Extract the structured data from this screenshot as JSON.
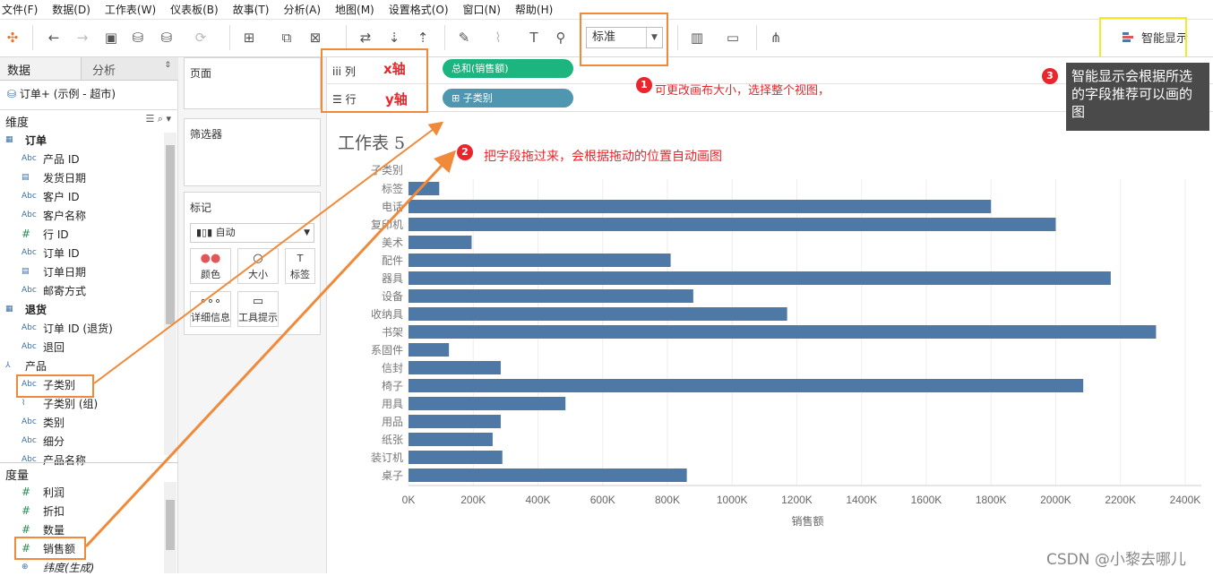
{
  "menu": [
    "文件(F)",
    "数据(D)",
    "工作表(W)",
    "仪表板(B)",
    "故事(T)",
    "分析(A)",
    "地图(M)",
    "设置格式(O)",
    "窗口(N)",
    "帮助(H)"
  ],
  "toolbar": {
    "fit_value": "标准",
    "show_me": "智能显示"
  },
  "left": {
    "tab_data": "数据",
    "tab_analysis": "分析",
    "datasource": "订单+ (示例 - 超市)",
    "dimensions_label": "维度",
    "measures_label": "度量",
    "dimensions": [
      {
        "type": "table",
        "label": "订单"
      },
      {
        "type": "abc",
        "label": "产品 ID"
      },
      {
        "type": "date",
        "label": "发货日期"
      },
      {
        "type": "abc",
        "label": "客户 ID"
      },
      {
        "type": "abc",
        "label": "客户名称"
      },
      {
        "type": "num",
        "label": "行 ID"
      },
      {
        "type": "abc",
        "label": "订单 ID"
      },
      {
        "type": "date",
        "label": "订单日期"
      },
      {
        "type": "abc",
        "label": "邮寄方式"
      },
      {
        "type": "table",
        "label": "退货"
      },
      {
        "type": "abc",
        "label": "订单 ID (退货)"
      },
      {
        "type": "abc",
        "label": "退回"
      },
      {
        "type": "hier",
        "label": "产品"
      },
      {
        "type": "abc",
        "label": "子类别"
      },
      {
        "type": "clip",
        "label": "子类别 (组)"
      },
      {
        "type": "abc",
        "label": "类别"
      },
      {
        "type": "abc",
        "label": "细分"
      },
      {
        "type": "abc",
        "label": "产品名称"
      }
    ],
    "measures": [
      {
        "type": "num",
        "label": "利润"
      },
      {
        "type": "num",
        "label": "折扣"
      },
      {
        "type": "num",
        "label": "数量"
      },
      {
        "type": "num",
        "label": "销售额"
      },
      {
        "type": "geo",
        "label": "纬度(生成)"
      }
    ]
  },
  "cards": {
    "pages": "页面",
    "filters": "筛选器",
    "marks": "标记",
    "mark_type": "自动",
    "color": "颜色",
    "size": "大小",
    "label": "标签",
    "detail": "详细信息",
    "tooltip": "工具提示"
  },
  "shelves": {
    "columns": "列",
    "rows": "行",
    "columns_pill": "总和(销售额)",
    "rows_pill": "子类别"
  },
  "annotations": {
    "x_axis": "x轴",
    "y_axis": "y轴",
    "note1": "可更改画布大小，选择整个视图，",
    "note2": "把字段拖过来，会根据拖动的位置自动画图",
    "note3": "智能显示会根据所选的字段推荐可以画的图",
    "b1": "1",
    "b2": "2",
    "b3": "3"
  },
  "sheet_title": "工作表 5",
  "watermark": "CSDN @小黎去哪儿",
  "colors": {
    "bar": "#4e79a7",
    "pill_green": "#1cb47f",
    "pill_blue": "#4f96b0",
    "annotation": "#f08a3a",
    "red": "#e8262b"
  },
  "chart_data": {
    "type": "bar",
    "orientation": "horizontal",
    "row_header": "子类别",
    "categories": [
      "标签",
      "电话",
      "复印机",
      "美术",
      "配件",
      "器具",
      "设备",
      "收纳具",
      "书架",
      "系固件",
      "信封",
      "椅子",
      "用具",
      "用品",
      "纸张",
      "装订机",
      "桌子"
    ],
    "values": [
      95000,
      1800000,
      2000000,
      195000,
      810000,
      2170000,
      880000,
      1170000,
      2310000,
      125000,
      285000,
      2085000,
      485000,
      285000,
      260000,
      290000,
      860000
    ],
    "xlabel": "销售额",
    "xlim": [
      0,
      2450000
    ],
    "ticks": [
      0,
      200000,
      400000,
      600000,
      800000,
      1000000,
      1200000,
      1400000,
      1600000,
      1800000,
      2000000,
      2200000,
      2400000
    ],
    "tick_labels": [
      "0K",
      "200K",
      "400K",
      "600K",
      "800K",
      "1000K",
      "1200K",
      "1400K",
      "1600K",
      "1800K",
      "2000K",
      "2200K",
      "2400K"
    ],
    "grid": true
  }
}
